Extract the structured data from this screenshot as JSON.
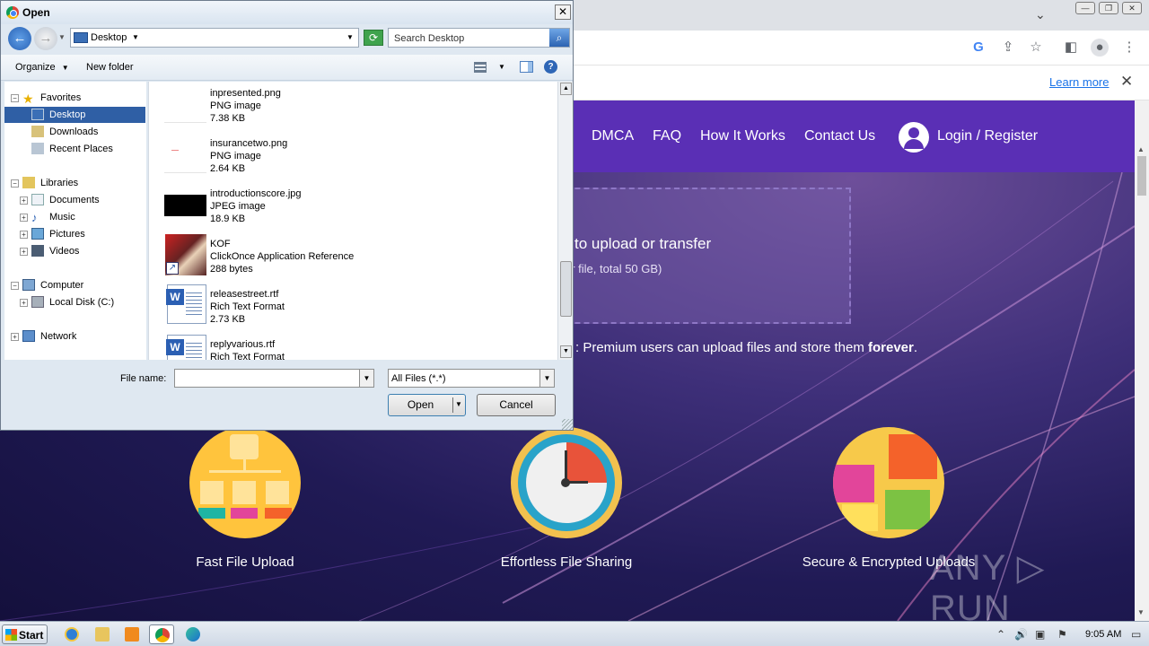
{
  "browser": {
    "tab_controls": {
      "minimize": "—",
      "restore": "❐",
      "close": "✕",
      "tab_search": "⌄"
    },
    "toolbar_icons": [
      "google-icon",
      "share-icon",
      "star-icon",
      "sidepanel-icon",
      "profile-icon",
      "menu-icon"
    ],
    "infobar": {
      "learn_more": "Learn more",
      "close": "✕"
    }
  },
  "site": {
    "nav": [
      "DMCA",
      "FAQ",
      "How It Works",
      "Contact Us"
    ],
    "login": "Login / Register",
    "drop_title": "to upload or transfer",
    "drop_sub": "er file, total 50 GB)",
    "premium_note_prefix": ": Premium users can upload files and store them ",
    "premium_note_bold": "forever",
    "premium_note_suffix": ".",
    "features": [
      {
        "label": "Fast File Upload",
        "icon": "flowchart-icon"
      },
      {
        "label": "Effortless File Sharing",
        "icon": "clock-icon"
      },
      {
        "label": "Secure & Encrypted Uploads",
        "icon": "puzzle-icon"
      }
    ],
    "watermark": "ANY ▷ RUN"
  },
  "dialog": {
    "title": "Open",
    "close": "✕",
    "address": "Desktop",
    "search_placeholder": "Search Desktop",
    "commands": {
      "organize": "Organize",
      "new_folder": "New folder",
      "help": "?"
    },
    "nav_tree": {
      "favorites": "Favorites",
      "desktop": "Desktop",
      "downloads": "Downloads",
      "recent": "Recent Places",
      "libraries": "Libraries",
      "documents": "Documents",
      "music": "Music",
      "pictures": "Pictures",
      "videos": "Videos",
      "computer": "Computer",
      "local_disk": "Local Disk (C:)",
      "network": "Network"
    },
    "files": [
      {
        "name": "inpresented.png",
        "type": "PNG image",
        "size": "7.38 KB"
      },
      {
        "name": "insurancetwo.png",
        "type": "PNG image",
        "size": "2.64 KB"
      },
      {
        "name": "introductionscore.jpg",
        "type": "JPEG image",
        "size": "18.9 KB"
      },
      {
        "name": "KOF",
        "type": "ClickOnce Application Reference",
        "size": "288 bytes"
      },
      {
        "name": "releasestreet.rtf",
        "type": "Rich Text Format",
        "size": "2.73 KB"
      },
      {
        "name": "replyvarious.rtf",
        "type": "Rich Text Format",
        "size": ""
      }
    ],
    "file_name_label": "File name:",
    "file_name_value": "",
    "filter": "All Files (*.*)",
    "open": "Open",
    "cancel": "Cancel"
  },
  "taskbar": {
    "start": "Start",
    "time": "9:05 AM"
  }
}
